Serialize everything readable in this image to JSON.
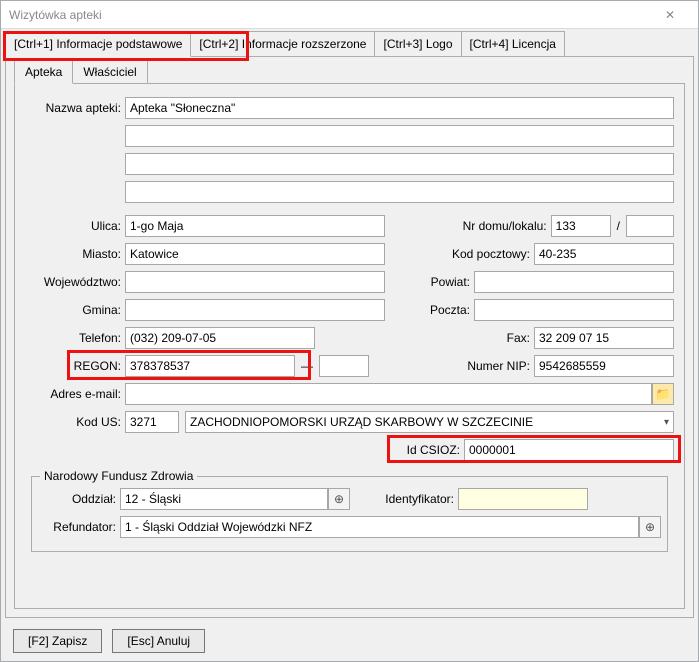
{
  "window": {
    "title": "Wizytówka apteki"
  },
  "tabs": {
    "t1": "[Ctrl+1] Informacje podstawowe",
    "t2": "[Ctrl+2] Informacje rozszerzone",
    "t3": "[Ctrl+3] Logo",
    "t4": "[Ctrl+4] Licencja"
  },
  "subtabs": {
    "a": "Apteka",
    "b": "Właściciel"
  },
  "labels": {
    "nazwa": "Nazwa apteki:",
    "ulica": "Ulica:",
    "nrdomu": "Nr domu/lokalu:",
    "miasto": "Miasto:",
    "kod": "Kod pocztowy:",
    "woj": "Województwo:",
    "powiat": "Powiat:",
    "gmina": "Gmina:",
    "poczta": "Poczta:",
    "tel": "Telefon:",
    "fax": "Fax:",
    "regon": "REGON:",
    "nip": "Numer NIP:",
    "email": "Adres e-mail:",
    "kodus": "Kod US:",
    "idcsioz": "Id CSIOZ:",
    "nfz_group": "Narodowy Fundusz Zdrowia",
    "oddzial": "Oddział:",
    "ident": "Identyfikator:",
    "refund": "Refundator:"
  },
  "values": {
    "nazwa": "Apteka \"Słoneczna\"",
    "ulica": "1-go Maja",
    "nrdomu": "133",
    "nrlokalu": "",
    "miasto": "Katowice",
    "kod": "40-235",
    "woj": "",
    "powiat": "",
    "gmina": "",
    "poczta": "",
    "tel": "(032) 209-07-05",
    "fax": "32 209 07 15",
    "regon": "378378537",
    "regon_suffix": "",
    "nip": "9542685559",
    "email": "",
    "kodus_code": "3271",
    "kodus_name": "ZACHODNIOPOMORSKI URZĄD SKARBOWY W SZCZECINIE",
    "idcsioz": "0000001",
    "oddzial": "12 - Śląski",
    "ident": "",
    "refund": "1 - Śląski Oddział Wojewódzki NFZ"
  },
  "buttons": {
    "save": "[F2] Zapisz",
    "cancel": "[Esc] Anuluj"
  },
  "icons": {
    "slash": "/",
    "dash": "—",
    "plus": "⊕",
    "chev": "▾"
  }
}
